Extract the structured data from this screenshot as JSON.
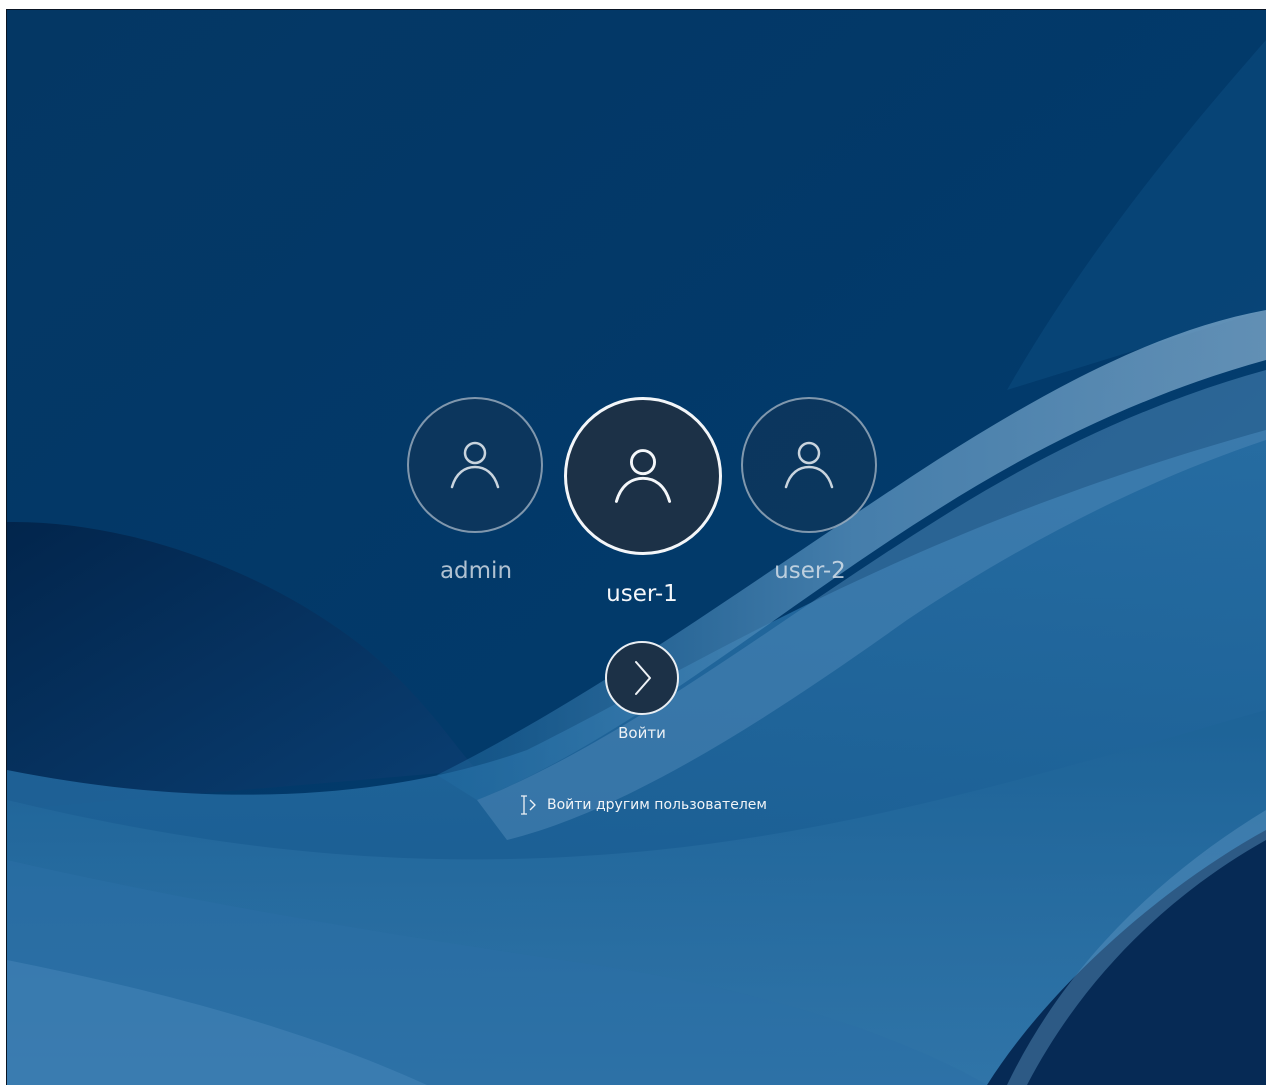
{
  "users": [
    {
      "name": "admin",
      "icon": "user-avatar-icon",
      "selected": false
    },
    {
      "name": "user-1",
      "icon": "user-avatar-icon",
      "selected": true
    },
    {
      "name": "user-2",
      "icon": "user-avatar-icon",
      "selected": false
    }
  ],
  "login_button": {
    "icon": "chevron-right-icon",
    "label": "Войти"
  },
  "other_user": {
    "icon": "cursor-arrow-icon",
    "label": "Войти другим пользователем"
  },
  "colors": {
    "background": "#033866",
    "avatar_fill": "#1c3147",
    "text": "#f5f7fa"
  }
}
